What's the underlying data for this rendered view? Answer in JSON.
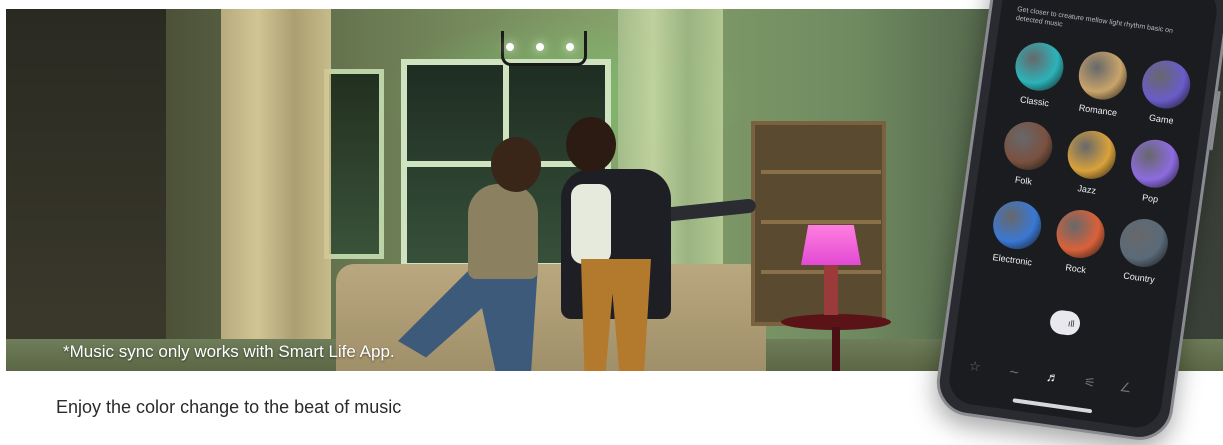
{
  "hero": {
    "disclaimer": "*Music sync only works with Smart Life App."
  },
  "caption": "Enjoy the color change to the beat of music",
  "phone": {
    "header_text": "Get closer to creature mellow light rhythm basic on detected music",
    "genres": [
      {
        "label": "Classic",
        "color": "#2bb3b9"
      },
      {
        "label": "Romance",
        "color": "#c9a46a"
      },
      {
        "label": "Game",
        "color": "#6a5cc9"
      },
      {
        "label": "Folk",
        "color": "#7a5140"
      },
      {
        "label": "Jazz",
        "color": "#d9a23b"
      },
      {
        "label": "Pop",
        "color": "#8d6be0"
      },
      {
        "label": "Electronic",
        "color": "#3a78d4"
      },
      {
        "label": "Rock",
        "color": "#d9613a"
      },
      {
        "label": "Country",
        "color": "#5a6a78"
      }
    ],
    "tabs": [
      {
        "icon": "star-icon",
        "glyph": "☆"
      },
      {
        "icon": "wave-icon",
        "glyph": "∼"
      },
      {
        "icon": "music-note-icon",
        "glyph": "♬"
      },
      {
        "icon": "sliders-icon",
        "glyph": "⚟"
      },
      {
        "icon": "brush-icon",
        "glyph": "∠"
      }
    ],
    "now_playing_bars": "ıll"
  }
}
